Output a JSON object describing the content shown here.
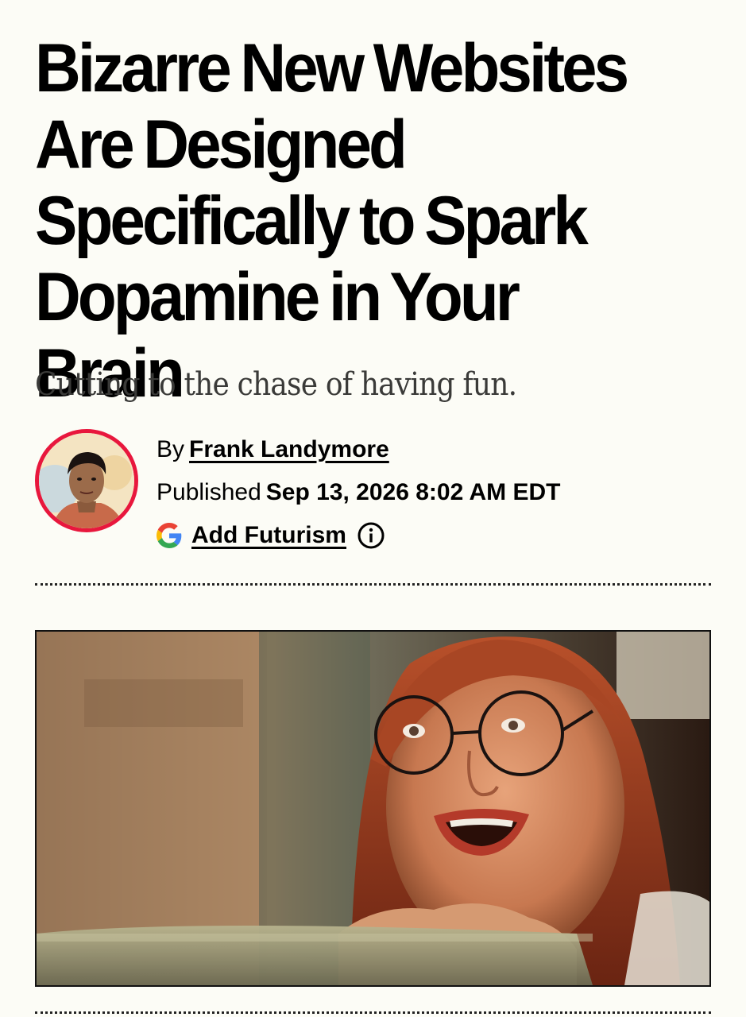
{
  "article": {
    "headline": "Bizarre New Websites Are Designed Specifically to Spark Dopamine in Your Brain",
    "subhead": "Cutting to the chase of having fun.",
    "byline": {
      "prefix": "By",
      "author": "Frank Landymore"
    },
    "published": {
      "label": "Published",
      "datetime": "Sep 13, 2026 8:02 AM EDT"
    },
    "add_source": {
      "label": "Add Futurism",
      "icon": "google-g-icon",
      "info_icon": "info-icon"
    },
    "avatar_icon": "author-avatar",
    "hero_image": "woman-with-glasses-excited-at-screen"
  },
  "colors": {
    "background": "#fcfcf6",
    "avatar_ring": "#e8173d",
    "text": "#000000",
    "subhead": "#3a3a38"
  }
}
